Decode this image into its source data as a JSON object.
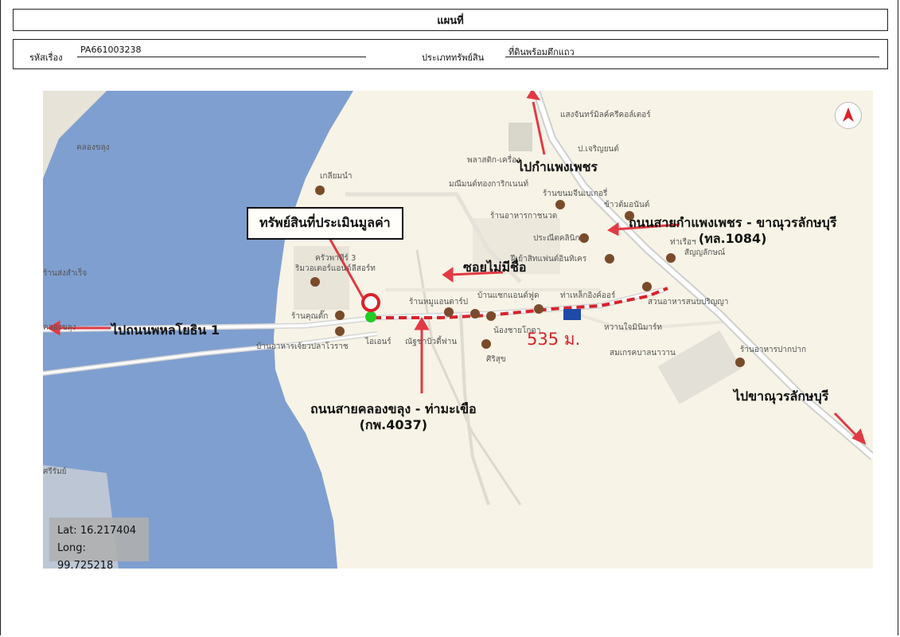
{
  "header": {
    "title": "แผนที่"
  },
  "info": {
    "case_code_label": "รหัสเรื่อง",
    "case_code_value": "PA661003238",
    "asset_type_label": "ประเภททรัพย์สิน",
    "asset_type_value": "ที่ดินพร้อมตึกแถว"
  },
  "map": {
    "callout_label": "ทรัพย์สินที่ประเมินมูลค่า",
    "annotations": {
      "to_kamphaeng_phet": "ไปกำแพงเพชร",
      "kp_road_line1": "ถนนสายกำแพงเพชร - ขาณุวรลักษบุรี",
      "kp_road_line2": "(ทล.1084)",
      "unnamed_soi": "ซอยไม่มีชื่อ",
      "to_phahonyothin": "ไปถนนพหลโยธิน 1",
      "local_road_line1": "ถนนสายคลองขลุง - ท่ามะเขือ",
      "local_road_line2": "(กพ.4037)",
      "to_khanu": "ไปขาณุวรลักษบุรี"
    },
    "distance": "535 ม.",
    "coordinates": {
      "lat_text": "Lat: 16.217404",
      "long_text": "Long: 99.725218"
    },
    "poi_labels": [
      "คลองขลุง",
      "แสงจันทร์มิลค์ครีคอล์เตอร์",
      "ป.เจริญยนต์",
      "พลาสติก-เครื่อง",
      "มณีมนต์ทองการิกเนนท์",
      "ร้านขนมจีนเบเกอรี่",
      "ข้าวต้มอนันต์",
      "ร้านอาหารกาชนวด",
      "ประณีตคลินิก",
      "ท่าเรือฯ",
      "สัญญลักษณ์",
      "ฝีเย้าสิทแฟนต์อินทิเคร",
      "ร้านหมูแอนดาร์ป",
      "บ้านแซกแอนด์ฟูด",
      "ท่าเหล็กอิงค์ออร์",
      "สวนอาหารสนบปริญญา",
      "หวานใจมินิมาร์ท",
      "สมเกรคบาลนาวาน",
      "ร้านอาหารปากปาก",
      "ร้านคุณตั๊ก",
      "บ้านอาหารเจ้ยวปลาโวราช",
      "ไอเอนร์",
      "ณัฐชาบิวตี้ฟาน",
      "น้องชายโกดา",
      "ศิริสุข",
      "ครัวพาทีร์ 3",
      "ริมวอเตอร์แอนด์ลีสอร์ท",
      "เกลียมนำ",
      "ร้านส่งสำเร็จ",
      "คลองขลุง",
      "ศรีรัมย์"
    ],
    "colors": {
      "water": "#7f9fd0",
      "land": "#f7f3e6",
      "road_major": "#c9c9c9",
      "highlight": "#d8232a",
      "marker_green": "#22cc22"
    },
    "compass_icon": "north-arrow-icon",
    "pin_icon": "location-pin-icon"
  }
}
